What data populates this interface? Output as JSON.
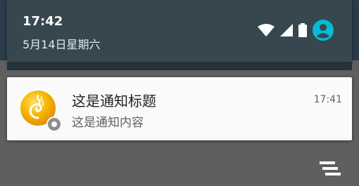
{
  "status_bar": {
    "time": "17:42",
    "date": "5月14日星期六",
    "icons": [
      "wifi-icon",
      "signal-icon",
      "battery-icon",
      "account-icon"
    ],
    "accent_color": "#00bcd4"
  },
  "notification": {
    "app_icon": "app-spiral-icon",
    "title": "这是通知标题",
    "text": "这是通知内容",
    "time": "17:41"
  },
  "actions": {
    "clear_all_icon": "clear-all-icon"
  }
}
